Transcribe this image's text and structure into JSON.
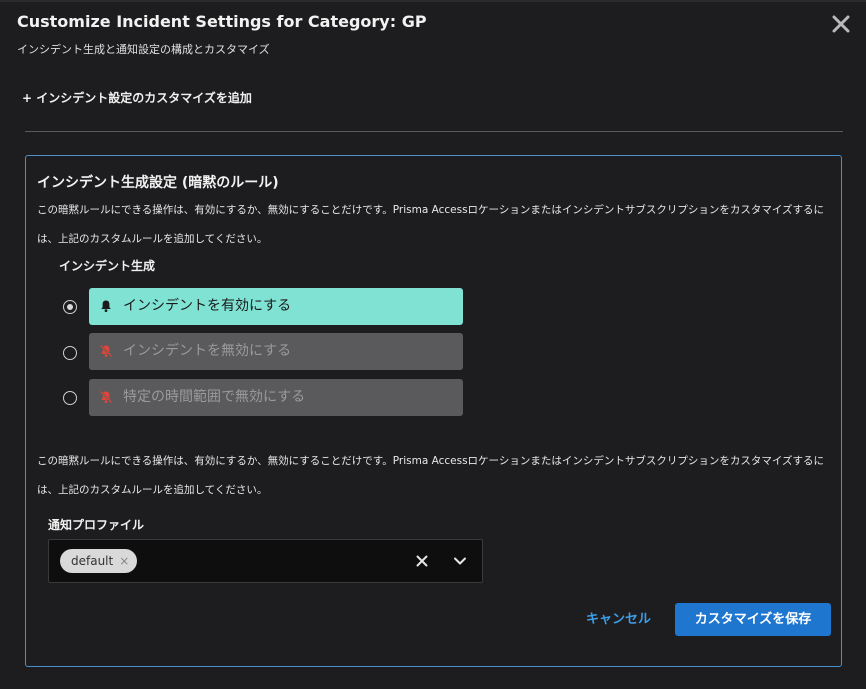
{
  "dialog": {
    "title": "Customize Incident Settings for Category: GP",
    "subtitle": "インシデント生成と通知設定の構成とカスタマイズ",
    "close_icon": "close-icon",
    "add_customization_label": "+ インシデント設定のカスタマイズを追加"
  },
  "panel": {
    "title": "インシデント生成設定 (暗黙のルール)",
    "description": "この暗黙ルールにできる操作は、有効にするか、無効にすることだけです。Prisma Accessロケーションまたはインシデントサブスクリプションをカスタマイズするには、上記のカスタムルールを追加してください。",
    "generation_label": "インシデント生成",
    "options": [
      {
        "label": "インシデントを有効にする",
        "icon": "bell-icon",
        "selected": true
      },
      {
        "label": "インシデントを無効にする",
        "icon": "bell-off-icon",
        "selected": false
      },
      {
        "label": "特定の時間範囲で無効にする",
        "icon": "bell-off-icon",
        "selected": false
      }
    ],
    "description2": "この暗黙ルールにできる操作は、有効にするか、無効にすることだけです。Prisma Accessロケーションまたはインシデントサブスクリプションをカスタマイズするには、上記のカスタムルールを追加してください。",
    "notification_profile_label": "通知プロファイル",
    "notification_profile_tag": "default",
    "cancel_label": "キャンセル",
    "save_label": "カスタマイズを保存"
  },
  "colors": {
    "accent_blue": "#1f76cf",
    "link_blue": "#3d9ee8",
    "enabled_option": "#7fe2d3",
    "disabled_option": "#5a5a5c",
    "bell_off_red": "#e0453a",
    "panel_border": "#4b8fc6"
  }
}
